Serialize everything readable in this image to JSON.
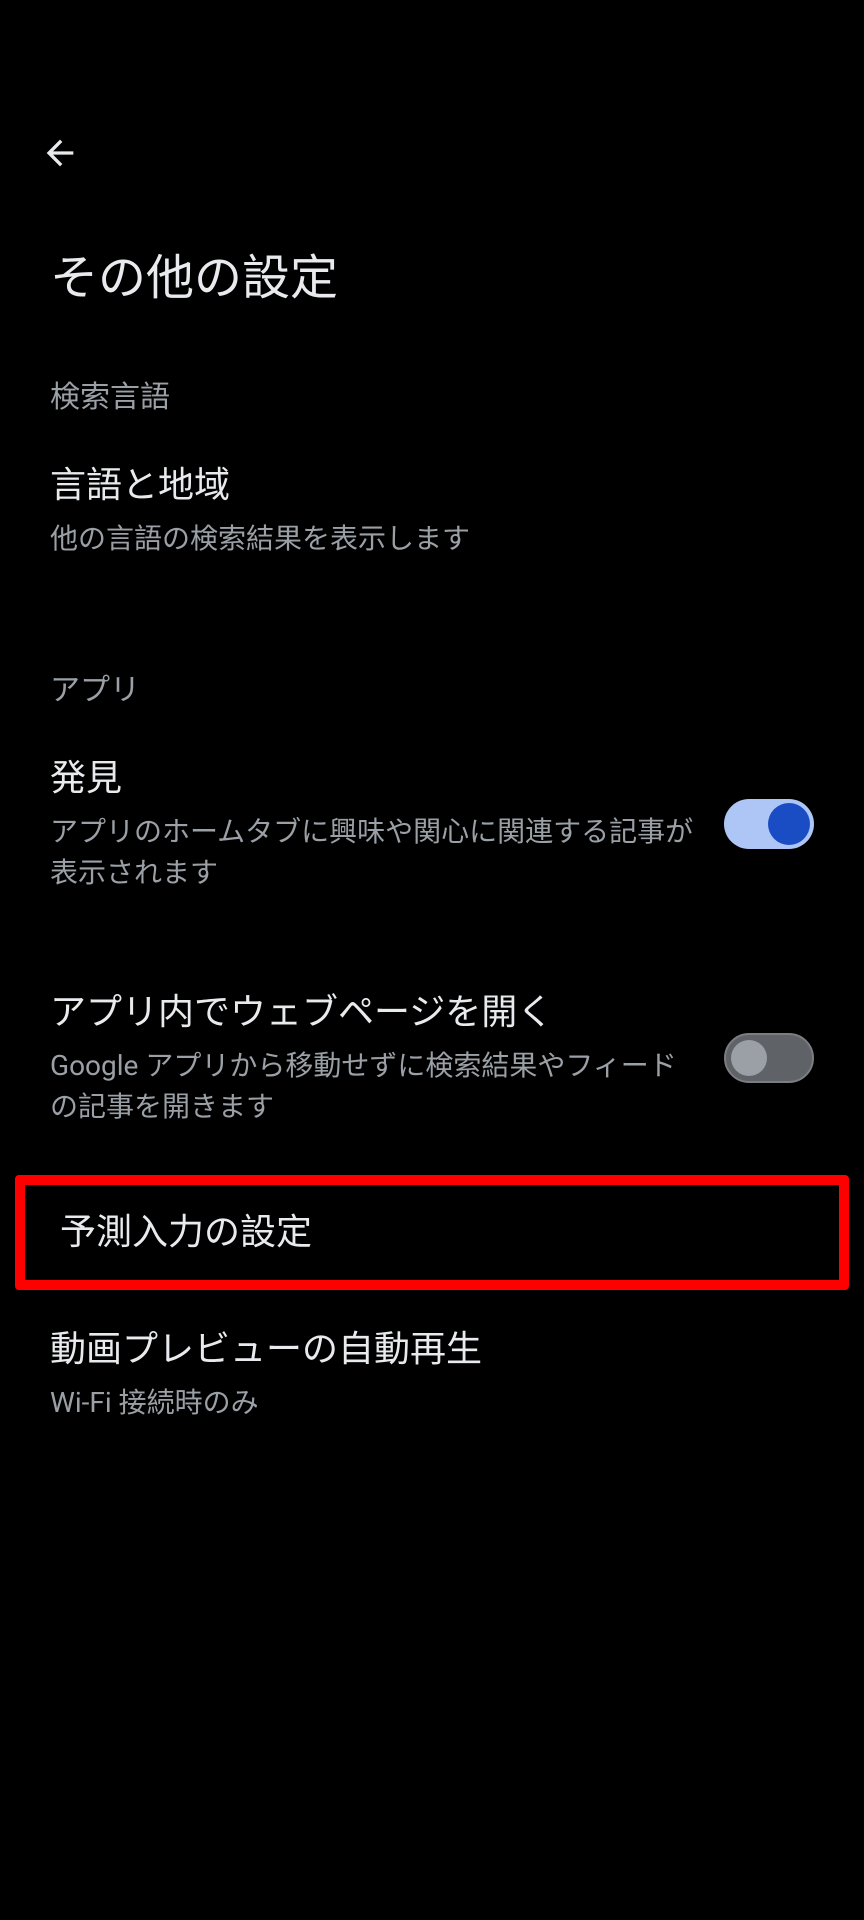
{
  "page_title": "その他の設定",
  "sections": {
    "search_language": {
      "header": "検索言語",
      "items": {
        "language_region": {
          "title": "言語と地域",
          "subtitle": "他の言語の検索結果を表示します"
        }
      }
    },
    "app": {
      "header": "アプリ",
      "items": {
        "discover": {
          "title": "発見",
          "subtitle": "アプリのホームタブに興味や関心に関連する記事が表示されます",
          "toggle": true
        },
        "open_web_in_app": {
          "title": "アプリ内でウェブページを開く",
          "subtitle": "Google アプリから移動せずに検索結果やフィードの記事を開きます",
          "toggle": false
        },
        "autocomplete": {
          "title": "予測入力の設定"
        },
        "video_preview": {
          "title": "動画プレビューの自動再生",
          "subtitle": "Wi-Fi 接続時のみ"
        }
      }
    }
  }
}
